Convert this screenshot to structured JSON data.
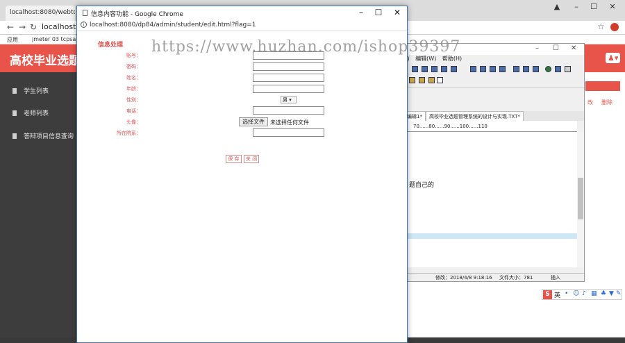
{
  "background_browser": {
    "tab_title": "localhost:8080/webtor",
    "url": "localhost",
    "bookmarks": [
      "应用",
      "jmeter 03 tcpsam"
    ],
    "header_title": "高校毕业选题管",
    "sidebar": [
      {
        "label": "学生列表"
      },
      {
        "label": "老师列表"
      },
      {
        "label": "答辩项目信息查询"
      }
    ],
    "op_labels": [
      "改",
      "删除"
    ]
  },
  "editor": {
    "menu": [
      "A)",
      "编辑(W)",
      "帮助(H)"
    ],
    "tabs": [
      "编辑1*",
      "高校毕业选题管理系统的设计与实现.TXT*"
    ],
    "ruler": "70......80......90......100......110",
    "text_line": "题自己的",
    "status_modified": "修改：2018/4/8 9:18:16",
    "status_size": "文件大小：781",
    "status_mode": "插入"
  },
  "ime": {
    "lang": "英"
  },
  "popup": {
    "window_title": "信息内容功能 - Google Chrome",
    "url": "localhost:8080/dp84/admin/student/edit.html?flag=1",
    "form_title": "信息处理",
    "fields": [
      {
        "label": "账号：",
        "value": "",
        "type": "text"
      },
      {
        "label": "密码：",
        "value": "",
        "type": "text"
      },
      {
        "label": "姓名：",
        "value": "",
        "type": "text"
      },
      {
        "label": "年龄：",
        "value": "",
        "type": "text"
      },
      {
        "label": "性别：",
        "value": "男",
        "type": "select"
      },
      {
        "label": "电话：",
        "value": "",
        "type": "text"
      },
      {
        "label": "头像：",
        "value": "",
        "type": "file"
      },
      {
        "label": "所在院系：",
        "value": "",
        "type": "text"
      }
    ],
    "file_button": "选择文件",
    "file_status": "未选择任何文件",
    "save_button": "保 存",
    "close_button": "关 闭"
  },
  "watermark": "https://www.huzhan.com/ishop39397"
}
